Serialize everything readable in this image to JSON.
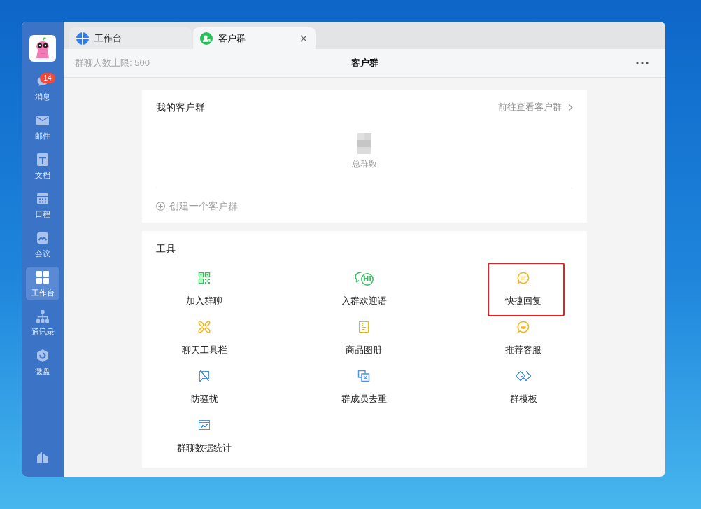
{
  "sidebar": {
    "items": [
      {
        "label": "消息",
        "badge": "14",
        "selected": false
      },
      {
        "label": "邮件",
        "selected": false
      },
      {
        "label": "文档",
        "selected": false
      },
      {
        "label": "日程",
        "selected": false
      },
      {
        "label": "会议",
        "selected": false
      },
      {
        "label": "工作台",
        "selected": true
      },
      {
        "label": "通讯录",
        "selected": false
      },
      {
        "label": "微盘",
        "selected": false
      }
    ]
  },
  "tabs": [
    {
      "label": "工作台",
      "color": "#2f7cf0",
      "selected": false,
      "closable": false
    },
    {
      "label": "客户群",
      "color": "#2bbf5a",
      "selected": true,
      "closable": true
    }
  ],
  "header": {
    "member_limit": "群聊人数上限: 500",
    "title": "客户群"
  },
  "my_groups": {
    "title": "我的客户群",
    "link": "前往查看客户群",
    "stat_label": "总群数",
    "create": "创建一个客户群"
  },
  "tools": {
    "title": "工具",
    "items": [
      {
        "label": "加入群聊",
        "color": "#35c05a",
        "highlighted": false
      },
      {
        "label": "入群欢迎语",
        "color": "#35c05a",
        "icon_text": "Hi",
        "highlighted": false
      },
      {
        "label": "快捷回复",
        "color": "#f5b416",
        "highlighted": true
      },
      {
        "label": "聊天工具栏",
        "color": "#f5b416",
        "highlighted": false
      },
      {
        "label": "商品图册",
        "color": "#f5b416",
        "highlighted": false
      },
      {
        "label": "推荐客服",
        "color": "#f5b416",
        "highlighted": false
      },
      {
        "label": "防骚扰",
        "color": "#4b92ea",
        "highlighted": false
      },
      {
        "label": "群成员去重",
        "color": "#4b92ea",
        "highlighted": false
      },
      {
        "label": "群模板",
        "color": "#4b92ea",
        "highlighted": false
      },
      {
        "label": "群聊数据统计",
        "color": "#4b92ea",
        "highlighted": false
      }
    ]
  }
}
